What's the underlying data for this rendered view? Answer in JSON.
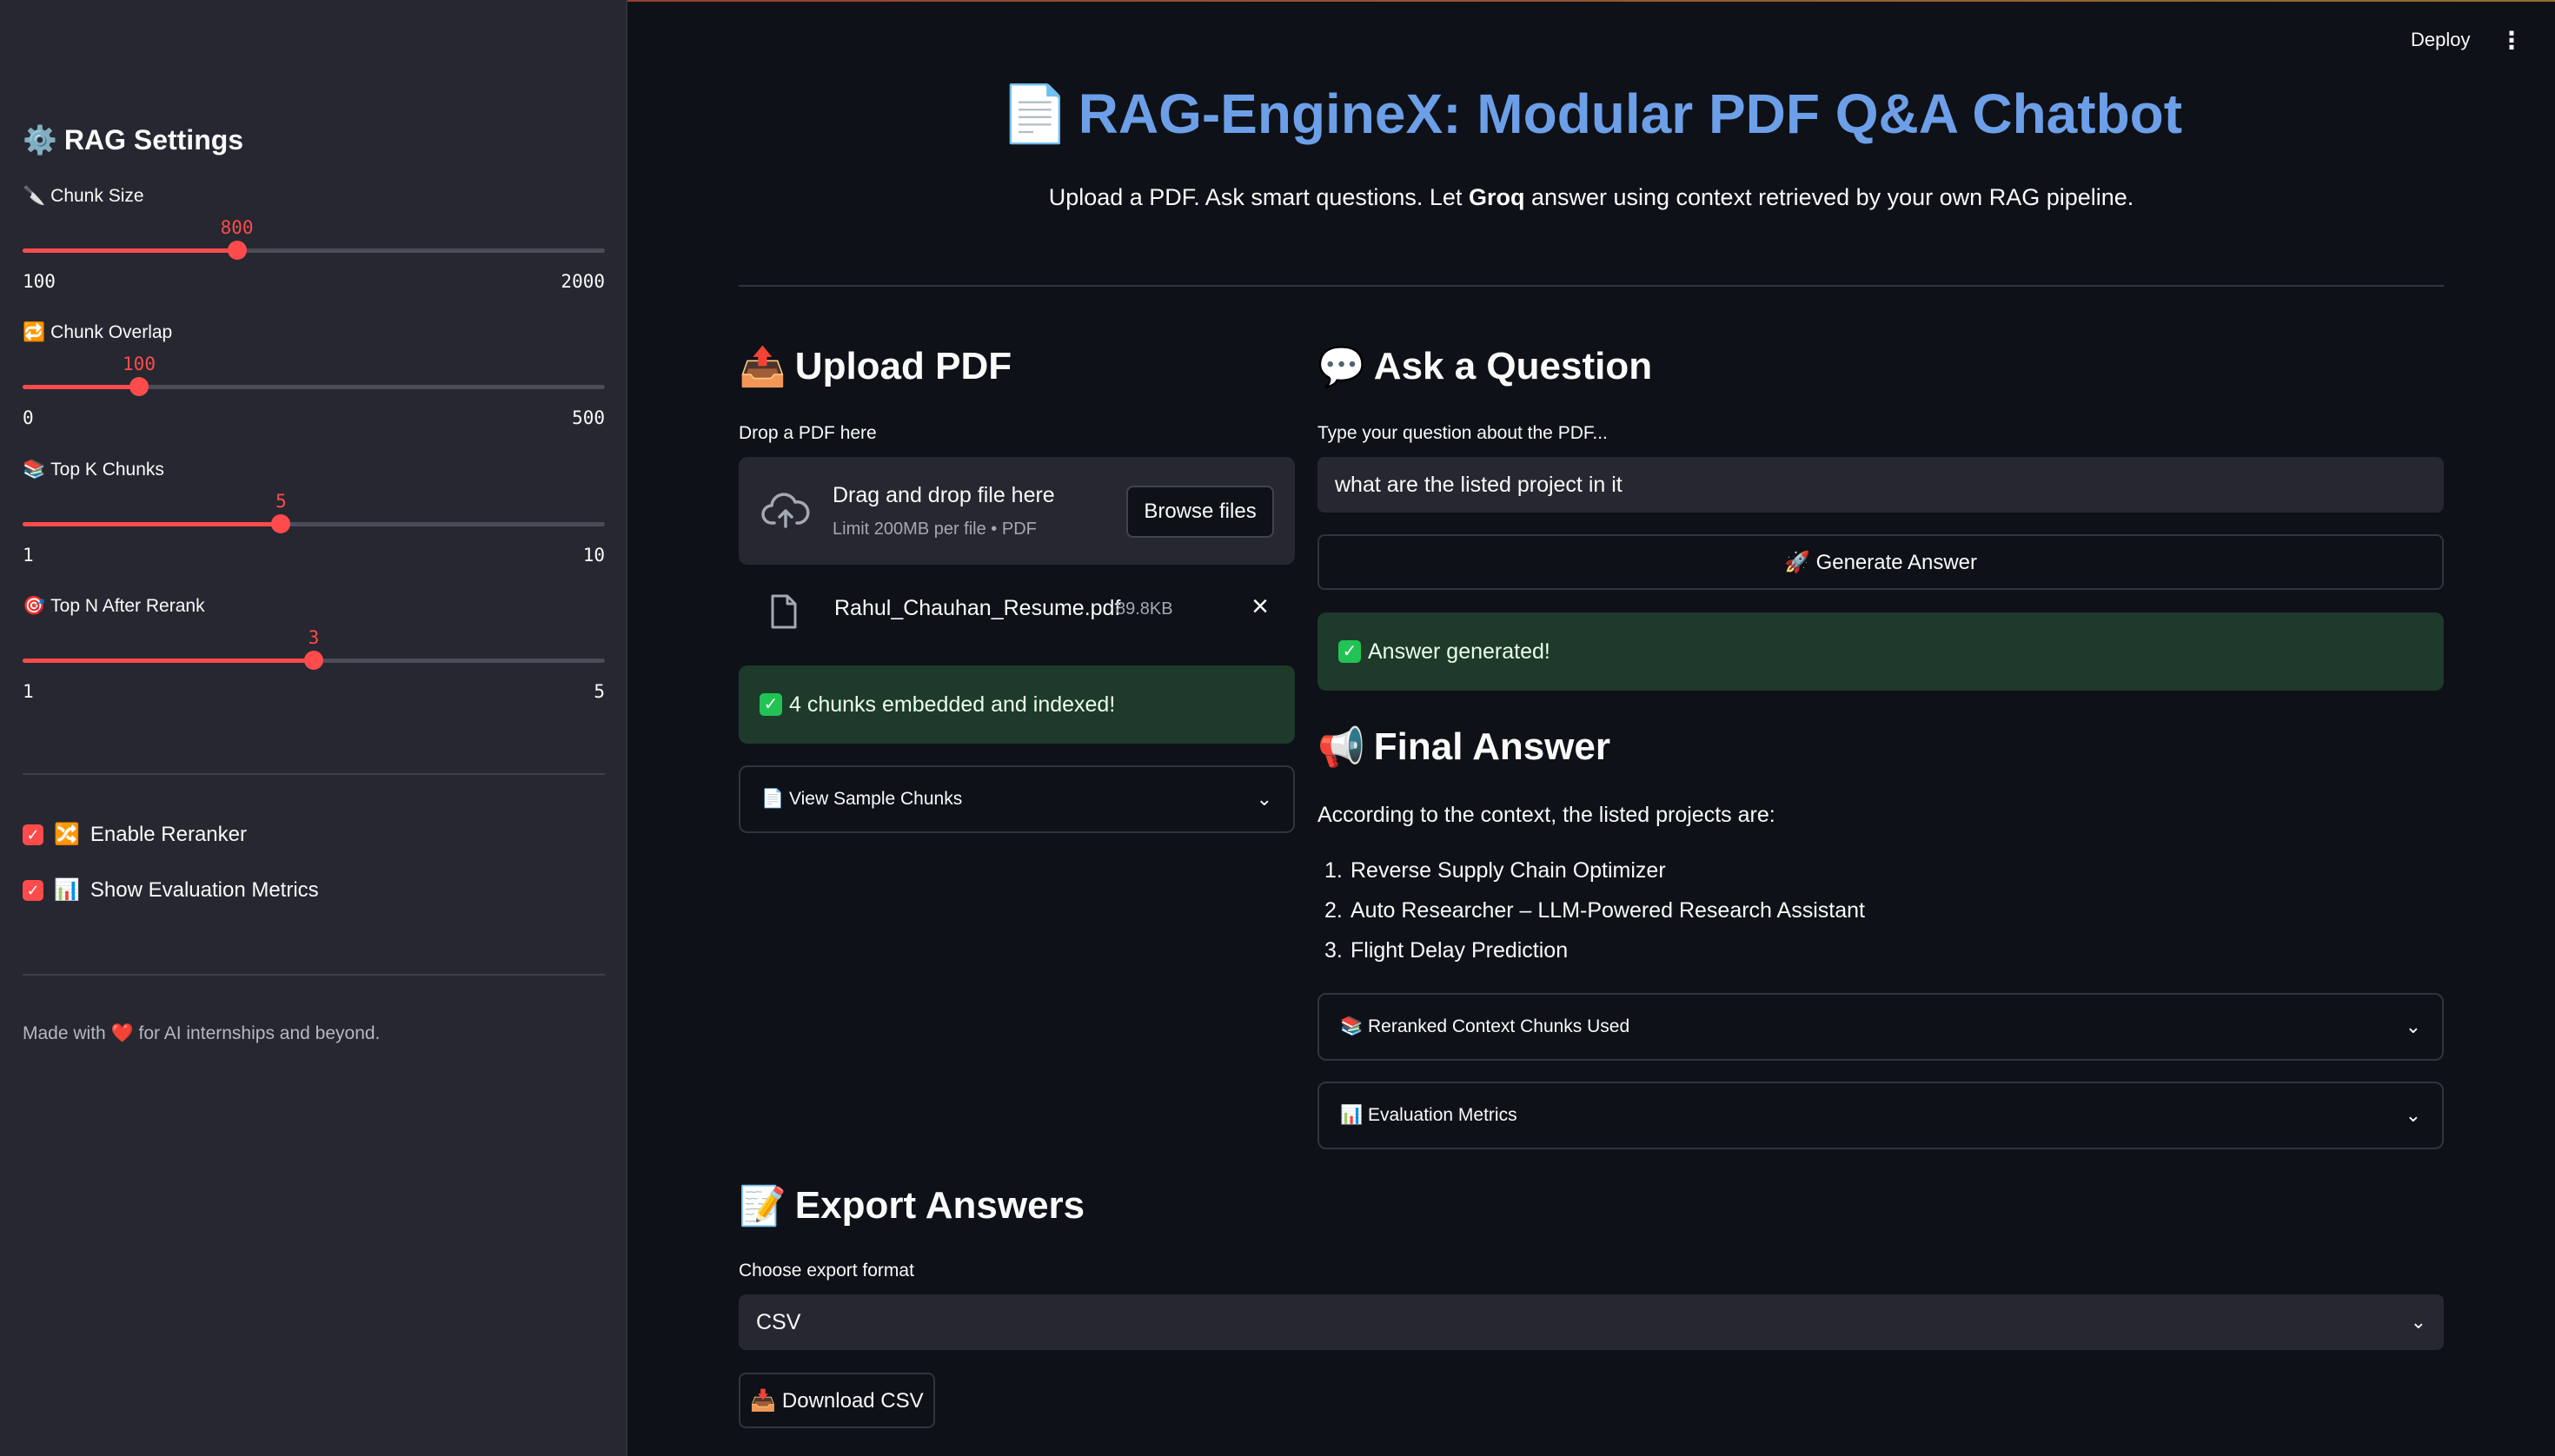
{
  "sidebar": {
    "title": "RAG Settings",
    "title_icon": "⚙️",
    "sliders": [
      {
        "icon": "🔪",
        "label": "Chunk Size",
        "value": "800",
        "min": "100",
        "max": "2000",
        "fraction": 0.368
      },
      {
        "icon": "🔁",
        "label": "Chunk Overlap",
        "value": "100",
        "min": "0",
        "max": "500",
        "fraction": 0.2
      },
      {
        "icon": "📚",
        "label": "Top K Chunks",
        "value": "5",
        "min": "1",
        "max": "10",
        "fraction": 0.444
      },
      {
        "icon": "🎯",
        "label": "Top N After Rerank",
        "value": "3",
        "min": "1",
        "max": "5",
        "fraction": 0.5
      }
    ],
    "checkboxes": [
      {
        "icon": "🔀",
        "label": "Enable Reranker",
        "checked": true
      },
      {
        "icon": "📊",
        "label": "Show Evaluation Metrics",
        "checked": true
      }
    ],
    "footer": {
      "before": "Made with ",
      "heart": "❤️",
      "after": " for AI internships and beyond."
    }
  },
  "header": {
    "deploy_label": "Deploy",
    "menu_icon": "⋮"
  },
  "main": {
    "title_icon": "📄",
    "title": "RAG-EngineX: Modular PDF Q&A Chatbot",
    "subtitle_before": "Upload a PDF. Ask smart questions. Let ",
    "subtitle_bold": "Groq",
    "subtitle_after": " answer using context retrieved by your own RAG pipeline."
  },
  "upload": {
    "heading_icon": "📤",
    "heading": "Upload PDF",
    "label": "Drop a PDF here",
    "dropzone_main": "Drag and drop file here",
    "dropzone_sub": "Limit 200MB per file • PDF",
    "browse_label": "Browse files",
    "file_name": "Rahul_Chauhan_Resume.pdf",
    "file_size": "89.8KB",
    "success_icon": "✓",
    "success": "4 chunks embedded and indexed!",
    "expander_icon": "📄",
    "expander": "View Sample Chunks"
  },
  "question": {
    "heading_icon": "💬",
    "heading": "Ask a Question",
    "label": "Type your question about the PDF...",
    "value": "what are the listed project in it",
    "button_icon": "🚀",
    "button": "Generate Answer",
    "success_icon": "✓",
    "success": "Answer generated!"
  },
  "answer": {
    "heading_icon": "📢",
    "heading": "Final Answer",
    "intro": "According to the context, the listed projects are:",
    "items": [
      {
        "n": "1.",
        "text": "Reverse Supply Chain Optimizer"
      },
      {
        "n": "2.",
        "text": "Auto Researcher – LLM-Powered Research Assistant"
      },
      {
        "n": "3.",
        "text": "Flight Delay Prediction"
      }
    ],
    "expanders": [
      {
        "icon": "📚",
        "label": "Reranked Context Chunks Used"
      },
      {
        "icon": "📊",
        "label": "Evaluation Metrics"
      }
    ]
  },
  "export": {
    "heading_icon": "📝",
    "heading": "Export Answers",
    "label": "Choose export format",
    "selected": "CSV",
    "button_icon": "📥",
    "button": "Download CSV"
  },
  "colors": {
    "accent": "#ff4b4b",
    "title": "#6c9fe8",
    "success_bg": "#1e3a2b",
    "sidebar_bg": "#262730",
    "main_bg": "#0e1117"
  }
}
